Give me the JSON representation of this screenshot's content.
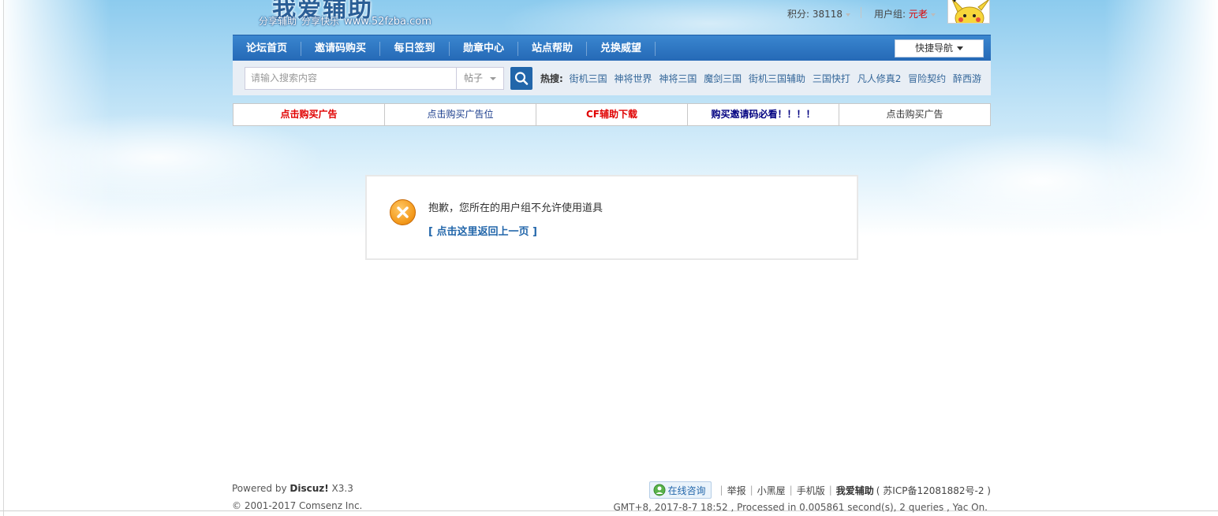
{
  "logo": {
    "title": "我爱辅助",
    "slogan1": "分享辅助",
    "slogan2": "分享快乐",
    "url": "www.52fzba.com"
  },
  "user": {
    "score_label": "积分: ",
    "score_value": "38118",
    "group_label": "用户组: ",
    "group_value": "元老"
  },
  "nav": {
    "items": [
      "论坛首页",
      "邀请码购买",
      "每日签到",
      "勋章中心",
      "站点帮助",
      "兑换威望"
    ],
    "quick_label": "快捷导航"
  },
  "search": {
    "placeholder": "请输入搜索内容",
    "type_value": "帖子",
    "hot_label": "热搜:",
    "hot_terms": [
      "街机三国",
      "神将世界",
      "神将三国",
      "魔剑三国",
      "街机三国辅助",
      "三国快打",
      "凡人修真2",
      "冒险契约",
      "醉西游"
    ]
  },
  "ads": [
    "点击购买广告",
    "点击购买广告位",
    "CF辅助下载",
    "购买邀请码必看！！！！",
    "点击购买广告"
  ],
  "message": {
    "text": "抱歉，您所在的用户组不允许使用道具",
    "back_link": "[ 点击这里返回上一页 ]"
  },
  "footer": {
    "powered_prefix": "Powered by ",
    "powered_name": "Discuz!",
    "powered_version": " X3.3",
    "copyright": "© 2001-2017 Comsenz Inc.",
    "consult": "在线咨询",
    "links": [
      "举报",
      "小黑屋",
      "手机版"
    ],
    "site_name": "我爱辅助",
    "icp": "( 苏ICP备12081882号-2 )",
    "stats": "GMT+8, 2017-8-7 18:52 , Processed in 0.005861 second(s), 2 queries , Yac On."
  },
  "colors": {
    "nav_bg": "#2569b6",
    "link": "#2266aa",
    "alert_red": "#e00000"
  }
}
